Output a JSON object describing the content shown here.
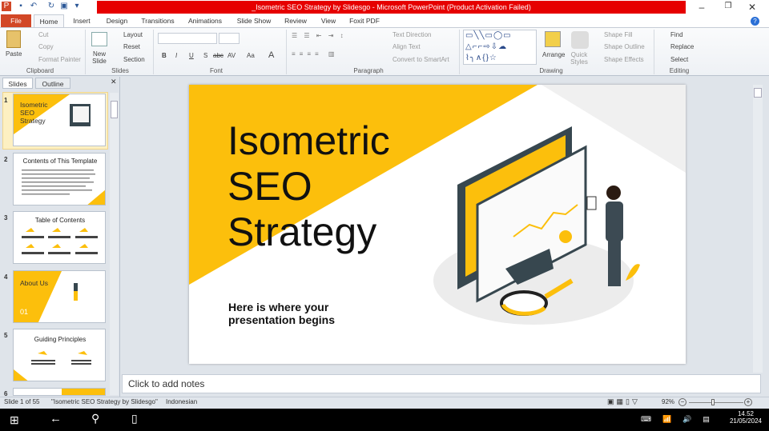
{
  "window": {
    "title": "_Isometric SEO Strategy by Slidesgo  -  Microsoft PowerPoint (Product Activation Failed)"
  },
  "tabs": [
    "File",
    "Home",
    "Insert",
    "Design",
    "Transitions",
    "Animations",
    "Slide Show",
    "Review",
    "View",
    "Foxit PDF"
  ],
  "ribbon": {
    "clipboard": {
      "paste": "Paste",
      "cut": "Cut",
      "copy": "Copy",
      "format_painter": "Format Painter",
      "label": "Clipboard"
    },
    "slides": {
      "new_slide": "New Slide",
      "layout": "Layout",
      "reset": "Reset",
      "section": "Section",
      "label": "Slides"
    },
    "font": {
      "label": "Font",
      "bold": "B",
      "italic": "I",
      "underline": "U",
      "shadow": "S",
      "strike": "abc",
      "spacing": "AV",
      "case": "Aa",
      "color": "A"
    },
    "paragraph": {
      "text_direction": "Text Direction",
      "align_text": "Align Text",
      "convert_smartart": "Convert to SmartArt",
      "label": "Paragraph"
    },
    "drawing": {
      "arrange": "Arrange",
      "quick_styles": "Quick Styles",
      "shape_fill": "Shape Fill",
      "shape_outline": "Shape Outline",
      "shape_effects": "Shape Effects",
      "label": "Drawing"
    },
    "editing": {
      "find": "Find",
      "replace": "Replace",
      "select": "Select",
      "label": "Editing"
    }
  },
  "panel": {
    "tabs": [
      "Slides",
      "Outline"
    ],
    "thumbs": [
      {
        "num": "1",
        "title": "Isometric SEO Strategy"
      },
      {
        "num": "2",
        "title": "Contents of This Template"
      },
      {
        "num": "3",
        "title": "Table of Contents"
      },
      {
        "num": "4",
        "title": "About Us",
        "sub": "01"
      },
      {
        "num": "5",
        "title": "Guiding Principles"
      },
      {
        "num": "6",
        "title": ""
      }
    ]
  },
  "slide": {
    "title_lines": [
      "Isometric",
      "SEO",
      "Strategy"
    ],
    "subtitle_lines": [
      "Here is where your",
      "presentation begins"
    ],
    "accent": "#fcbf0c"
  },
  "notes": {
    "placeholder": "Click to add notes"
  },
  "status": {
    "slide": "Slide 1 of 55",
    "theme": "\"Isometric SEO Strategy by Slidesgo\"",
    "language": "Indonesian",
    "zoom": "92%",
    "zoom_percent": 92
  },
  "taskbar": {
    "time": "14.52",
    "date": "21/05/2024"
  }
}
